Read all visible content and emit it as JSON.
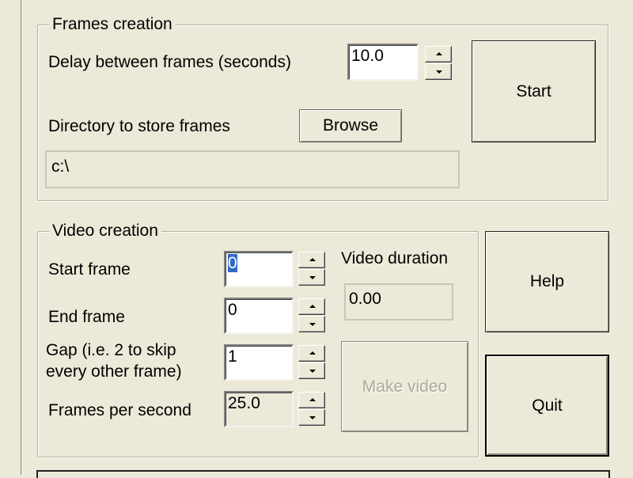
{
  "frames_creation": {
    "title": "Frames creation",
    "delay_label": "Delay between frames (seconds)",
    "delay_value": "10.0",
    "directory_label": "Directory to store frames",
    "browse_label": "Browse",
    "directory_value": "c:\\",
    "start_label": "Start"
  },
  "video_creation": {
    "title": "Video creation",
    "start_frame_label": "Start frame",
    "start_frame_value": "0",
    "end_frame_label": "End frame",
    "end_frame_value": "0",
    "gap_label_line1": "Gap (i.e. 2 to skip",
    "gap_label_line2": "every other frame)",
    "gap_value": "1",
    "fps_label": "Frames per second",
    "fps_value": "25.0",
    "duration_label": "Video duration",
    "duration_value": "0.00",
    "make_video_label": "Make video"
  },
  "buttons": {
    "help_label": "Help",
    "quit_label": "Quit"
  },
  "colors": {
    "window_bg": "#ece9d8",
    "selection": "#316ac5"
  }
}
